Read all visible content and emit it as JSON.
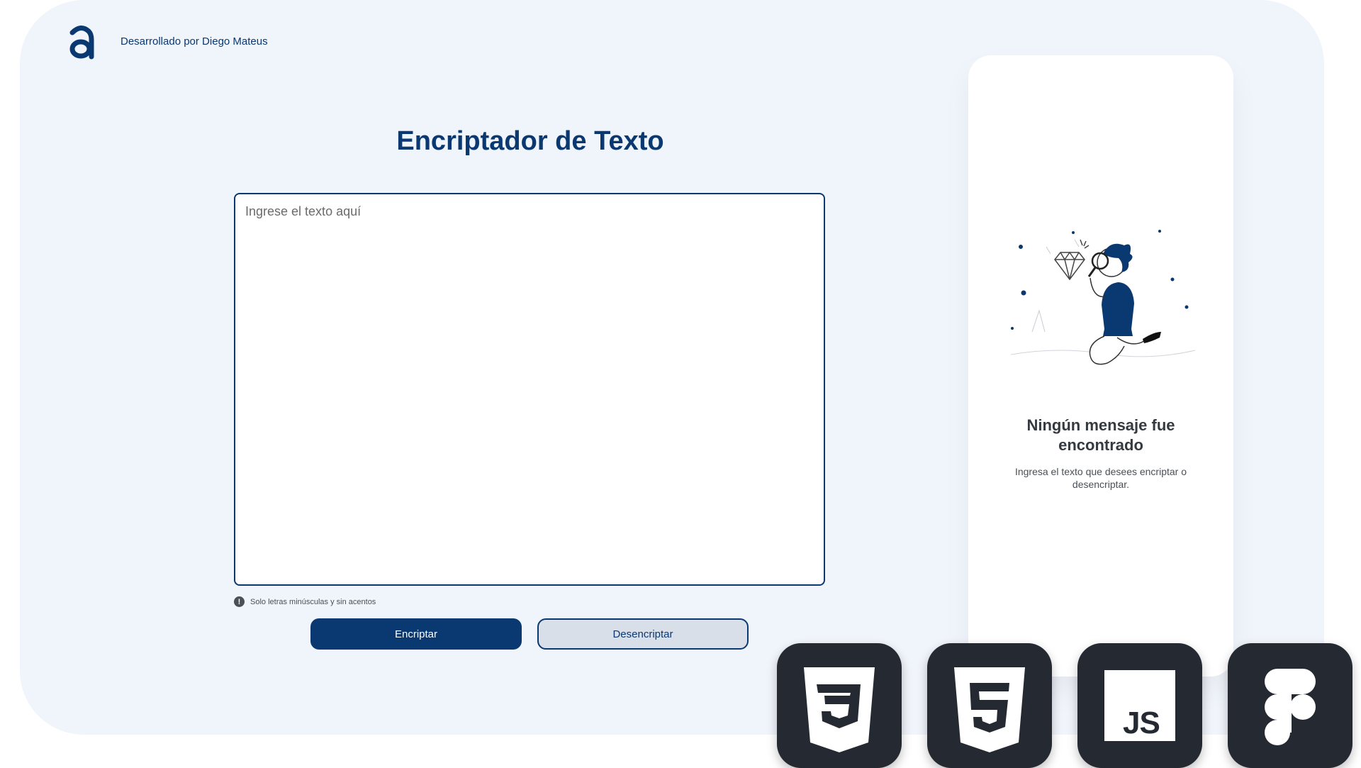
{
  "header": {
    "logo_letter": "a",
    "credits": "Desarrollado por Diego Mateus"
  },
  "main": {
    "title": "Encriptador de Texto",
    "input_placeholder": "Ingrese el texto aquí",
    "input_value": "",
    "hint_icon": "!",
    "hint": "Solo letras minúsculas y sin acentos",
    "encrypt_label": "Encriptar",
    "decrypt_label": "Desencriptar"
  },
  "output": {
    "illustration": "person-with-magnifying-glass-illustration",
    "empty_title": "Ningún mensaje fue encontrado",
    "empty_subtitle": "Ingresa el texto que desees encriptar o desencriptar."
  },
  "tech_badges": [
    {
      "icon": "css3-icon"
    },
    {
      "icon": "html5-icon"
    },
    {
      "icon": "javascript-icon",
      "label": "JS"
    },
    {
      "icon": "figma-icon"
    }
  ],
  "colors": {
    "primary": "#0a3871",
    "background": "#f0f4fb",
    "card": "#ffffff",
    "badge": "#252932"
  }
}
